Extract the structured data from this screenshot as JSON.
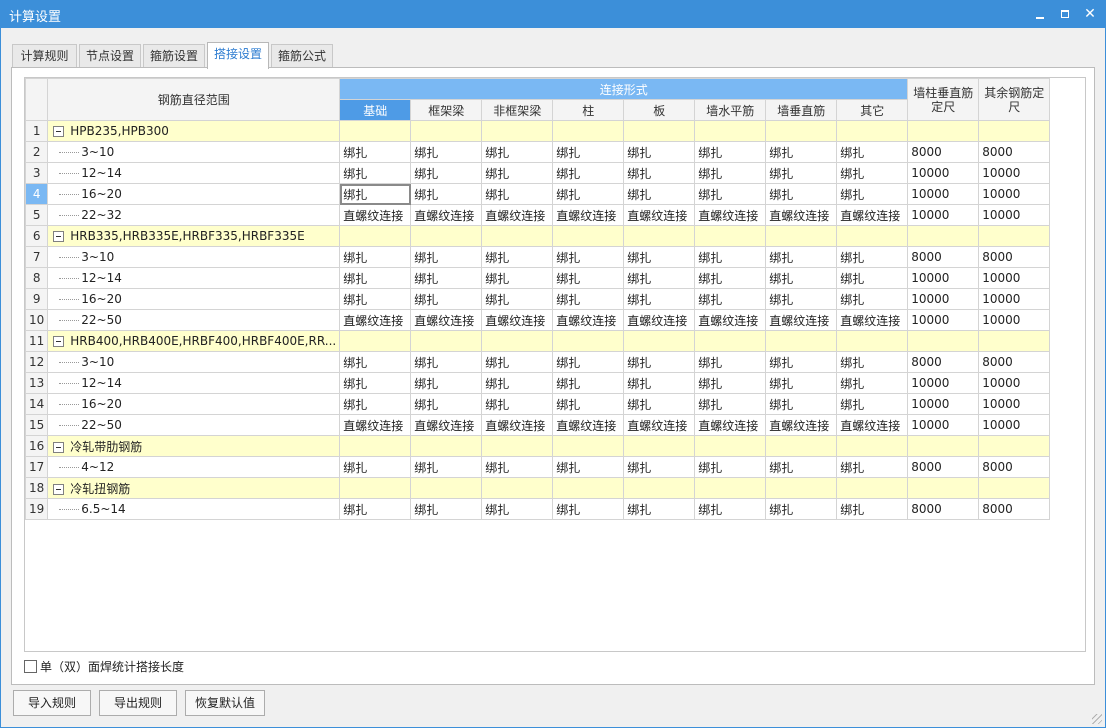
{
  "window": {
    "title": "计算设置",
    "min": "—",
    "max": "□",
    "close": "✕"
  },
  "tabs": [
    "计算规则",
    "节点设置",
    "箍筋设置",
    "搭接设置",
    "箍筋公式"
  ],
  "active_tab": 3,
  "grid": {
    "header": {
      "range": "钢筋直径范围",
      "group": "连接形式",
      "cols": [
        "基础",
        "框架梁",
        "非框架梁",
        "柱",
        "板",
        "墙水平筋",
        "墙垂直筋",
        "其它"
      ],
      "wall_col_l1": "墙柱垂直筋",
      "wall_col_l2": "定尺",
      "other_col_l1": "其余钢筋定",
      "other_col_l2": "尺"
    },
    "rows": [
      {
        "n": "1",
        "group": true,
        "label": "HPB235,HPB300"
      },
      {
        "n": "2",
        "label": "3~10",
        "vals": [
          "绑扎",
          "绑扎",
          "绑扎",
          "绑扎",
          "绑扎",
          "绑扎",
          "绑扎",
          "绑扎",
          "8000",
          "8000"
        ]
      },
      {
        "n": "3",
        "label": "12~14",
        "vals": [
          "绑扎",
          "绑扎",
          "绑扎",
          "绑扎",
          "绑扎",
          "绑扎",
          "绑扎",
          "绑扎",
          "10000",
          "10000"
        ]
      },
      {
        "n": "4",
        "label": "16~20",
        "vals": [
          "绑扎",
          "绑扎",
          "绑扎",
          "绑扎",
          "绑扎",
          "绑扎",
          "绑扎",
          "绑扎",
          "10000",
          "10000"
        ],
        "selected": true
      },
      {
        "n": "5",
        "label": "22~32",
        "vals": [
          "直螺纹连接",
          "直螺纹连接",
          "直螺纹连接",
          "直螺纹连接",
          "直螺纹连接",
          "直螺纹连接",
          "直螺纹连接",
          "直螺纹连接",
          "10000",
          "10000"
        ]
      },
      {
        "n": "6",
        "group": true,
        "label": "HRB335,HRB335E,HRBF335,HRBF335E"
      },
      {
        "n": "7",
        "label": "3~10",
        "vals": [
          "绑扎",
          "绑扎",
          "绑扎",
          "绑扎",
          "绑扎",
          "绑扎",
          "绑扎",
          "绑扎",
          "8000",
          "8000"
        ]
      },
      {
        "n": "8",
        "label": "12~14",
        "vals": [
          "绑扎",
          "绑扎",
          "绑扎",
          "绑扎",
          "绑扎",
          "绑扎",
          "绑扎",
          "绑扎",
          "10000",
          "10000"
        ]
      },
      {
        "n": "9",
        "label": "16~20",
        "vals": [
          "绑扎",
          "绑扎",
          "绑扎",
          "绑扎",
          "绑扎",
          "绑扎",
          "绑扎",
          "绑扎",
          "10000",
          "10000"
        ]
      },
      {
        "n": "10",
        "label": "22~50",
        "vals": [
          "直螺纹连接",
          "直螺纹连接",
          "直螺纹连接",
          "直螺纹连接",
          "直螺纹连接",
          "直螺纹连接",
          "直螺纹连接",
          "直螺纹连接",
          "10000",
          "10000"
        ]
      },
      {
        "n": "11",
        "group": true,
        "label": "HRB400,HRB400E,HRBF400,HRBF400E,RR..."
      },
      {
        "n": "12",
        "label": "3~10",
        "vals": [
          "绑扎",
          "绑扎",
          "绑扎",
          "绑扎",
          "绑扎",
          "绑扎",
          "绑扎",
          "绑扎",
          "8000",
          "8000"
        ]
      },
      {
        "n": "13",
        "label": "12~14",
        "vals": [
          "绑扎",
          "绑扎",
          "绑扎",
          "绑扎",
          "绑扎",
          "绑扎",
          "绑扎",
          "绑扎",
          "10000",
          "10000"
        ]
      },
      {
        "n": "14",
        "label": "16~20",
        "vals": [
          "绑扎",
          "绑扎",
          "绑扎",
          "绑扎",
          "绑扎",
          "绑扎",
          "绑扎",
          "绑扎",
          "10000",
          "10000"
        ]
      },
      {
        "n": "15",
        "label": "22~50",
        "vals": [
          "直螺纹连接",
          "直螺纹连接",
          "直螺纹连接",
          "直螺纹连接",
          "直螺纹连接",
          "直螺纹连接",
          "直螺纹连接",
          "直螺纹连接",
          "10000",
          "10000"
        ]
      },
      {
        "n": "16",
        "group": true,
        "label": "冷轧带肋钢筋"
      },
      {
        "n": "17",
        "label": "4~12",
        "vals": [
          "绑扎",
          "绑扎",
          "绑扎",
          "绑扎",
          "绑扎",
          "绑扎",
          "绑扎",
          "绑扎",
          "8000",
          "8000"
        ]
      },
      {
        "n": "18",
        "group": true,
        "label": "冷轧扭钢筋"
      },
      {
        "n": "19",
        "label": "6.5~14",
        "vals": [
          "绑扎",
          "绑扎",
          "绑扎",
          "绑扎",
          "绑扎",
          "绑扎",
          "绑扎",
          "绑扎",
          "8000",
          "8000"
        ]
      }
    ]
  },
  "options": {
    "weld_checkbox_label": "单（双）面焊统计搭接长度",
    "weld_checked": false
  },
  "buttons": {
    "import": "导入规则",
    "export": "导出规则",
    "restore": "恢复默认值"
  },
  "colors": {
    "title_bar": "#3c8fd9",
    "header_blue": "#7ab8f3",
    "group_row": "#ffffcc",
    "active_tab_text": "#2b7bd0"
  }
}
